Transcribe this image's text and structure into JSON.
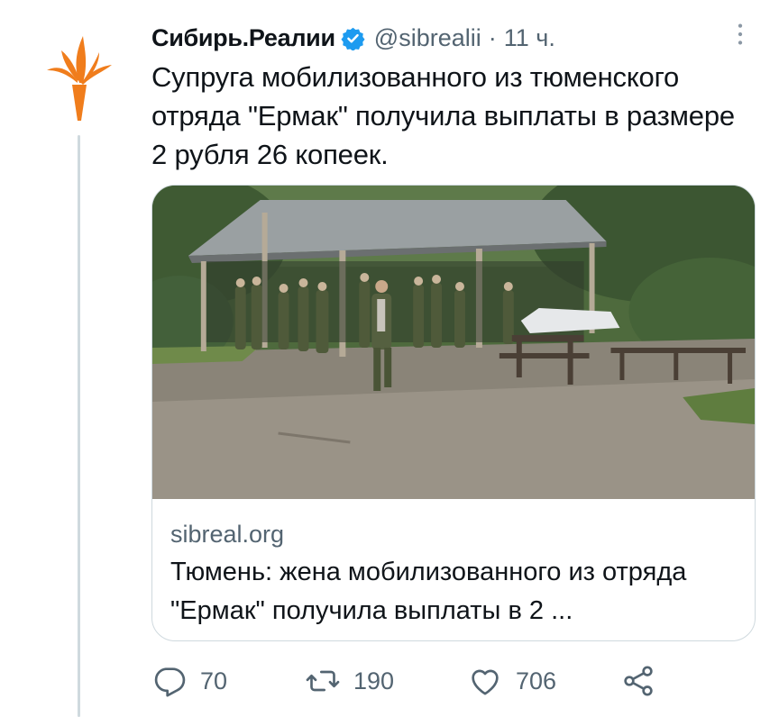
{
  "tweet": {
    "author": {
      "display_name": "Сибирь.Реалии",
      "handle": "@sibrealii",
      "verified": true,
      "avatar_icon": "torch-logo-icon"
    },
    "separator": "·",
    "timestamp": "11 ч.",
    "text": "Супруга мобилизованного из тюменского отряда \"Ермак\" получила выплаты в размере 2 рубля 26 копеек.",
    "card": {
      "domain": "sibreal.org",
      "title": "Тюмень: жена мобилизованного из отряда \"Ермак\" получила выплаты в 2 ..."
    },
    "actions": {
      "replies": "70",
      "retweets": "190",
      "likes": "706"
    }
  },
  "colors": {
    "text_primary": "#0f1419",
    "text_secondary": "#536471",
    "verified_blue": "#1d9bf0",
    "logo_orange": "#f07d1c",
    "border": "#cfd9de"
  }
}
